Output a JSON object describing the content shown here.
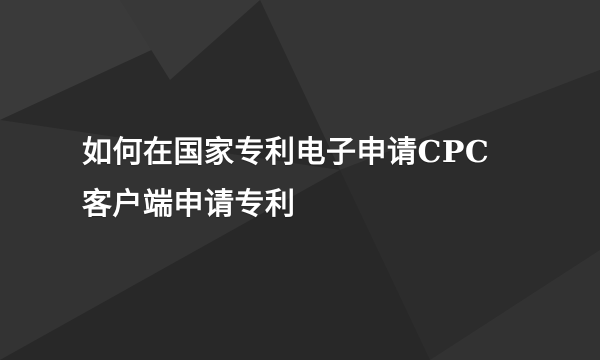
{
  "title": {
    "line1": "如何在国家专利电子申请CPC",
    "line2": "客户端申请专利"
  },
  "colors": {
    "background": "#303030",
    "text": "#ffffff"
  }
}
